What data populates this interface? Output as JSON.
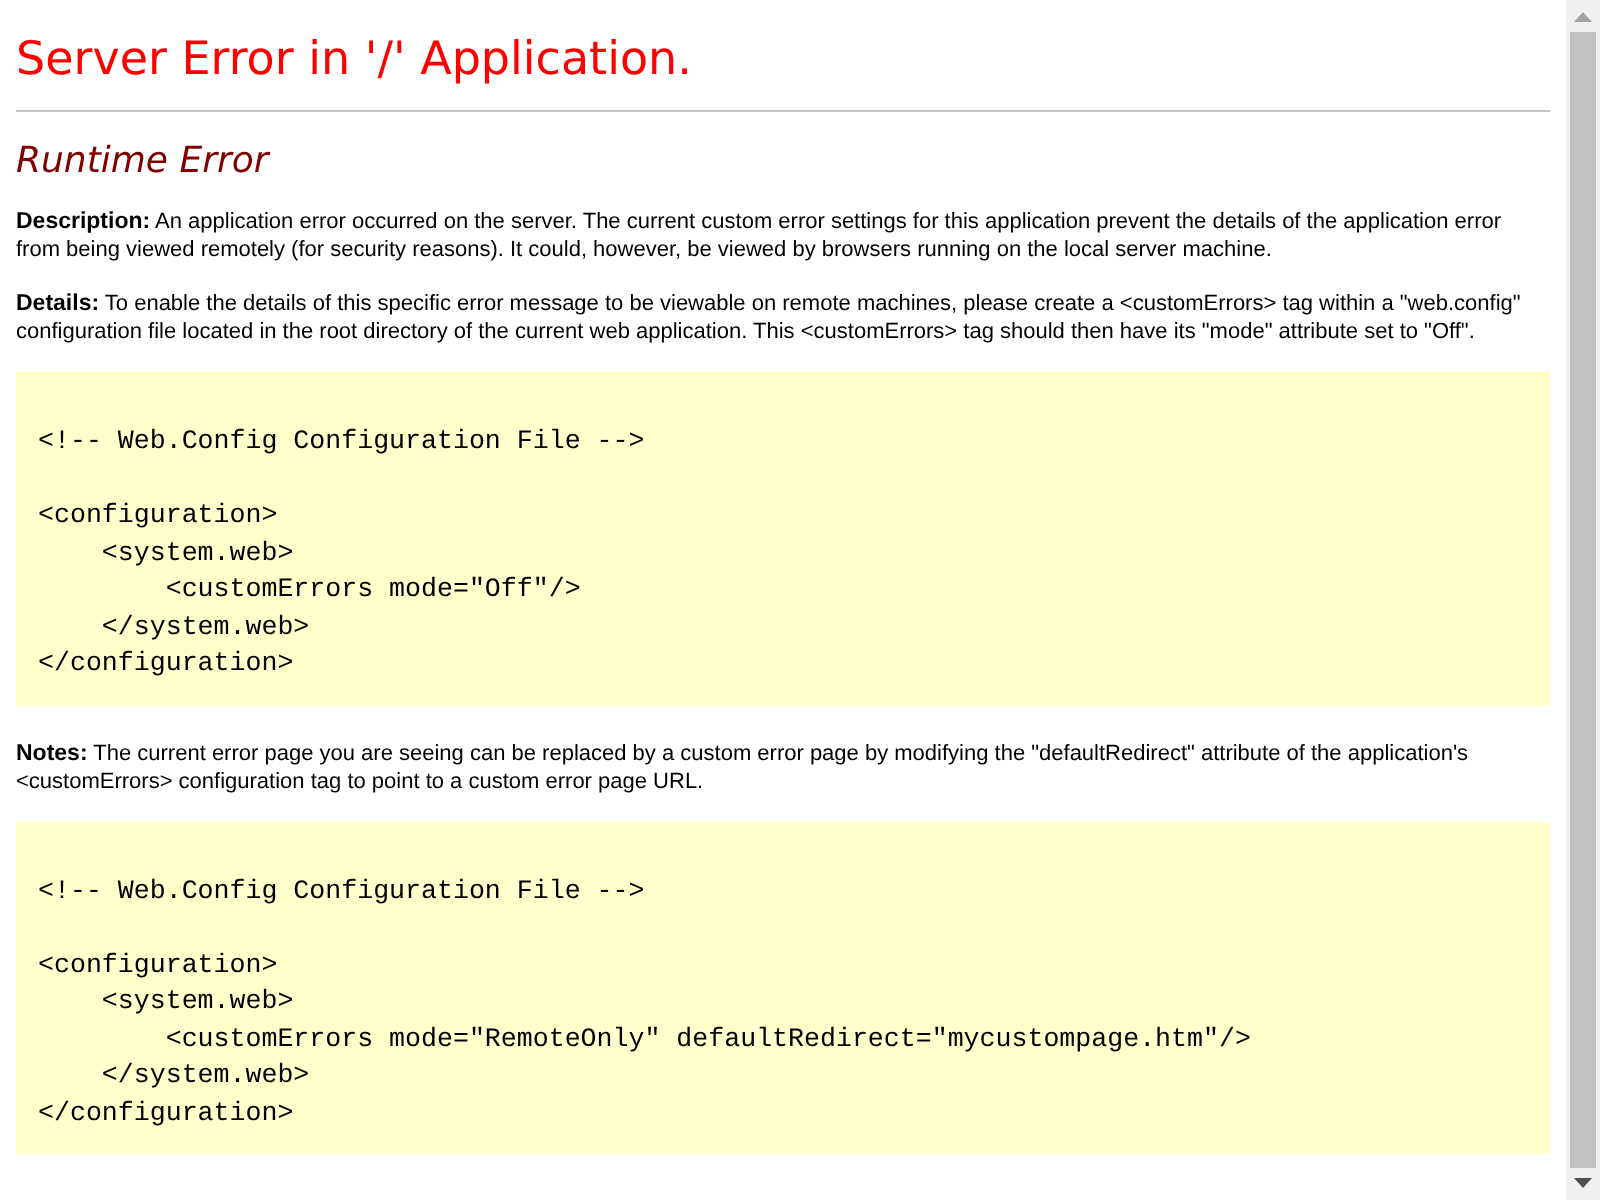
{
  "title": "Server Error in '/' Application.",
  "heading": "Runtime Error",
  "sections": [
    {
      "kind": "paragraph",
      "text": "**Description:** An application error occurred on the server. The current custom error settings for this application prevent the details of the application error from being viewed remotely (for security reasons). It could, however, be viewed by browsers running on the local server machine."
    },
    {
      "kind": "paragraph",
      "text": "**Details:** To enable the details of this specific error message to be viewable on remote machines, please create a <customErrors> tag within a \"web.config\" configuration file located in the root directory of the current web application. This <customErrors> tag should then have its \"mode\" attribute set to \"Off\"."
    },
    {
      "kind": "code",
      "text": "<!-- Web.Config Configuration File -->\n\n<configuration>\n    <system.web>\n        <customErrors mode=\"Off\"/>\n    </system.web>\n</configuration>"
    },
    {
      "kind": "paragraph",
      "text": "**Notes:** The current error page you are seeing can be replaced by a custom error page by modifying the \"defaultRedirect\" attribute of the application's <customErrors> configuration tag to point to a custom error page URL."
    },
    {
      "kind": "code",
      "text": "<!-- Web.Config Configuration File -->\n\n<configuration>\n    <system.web>\n        <customErrors mode=\"RemoteOnly\" defaultRedirect=\"mycustompage.htm\"/>\n    </system.web>\n</configuration>"
    }
  ]
}
